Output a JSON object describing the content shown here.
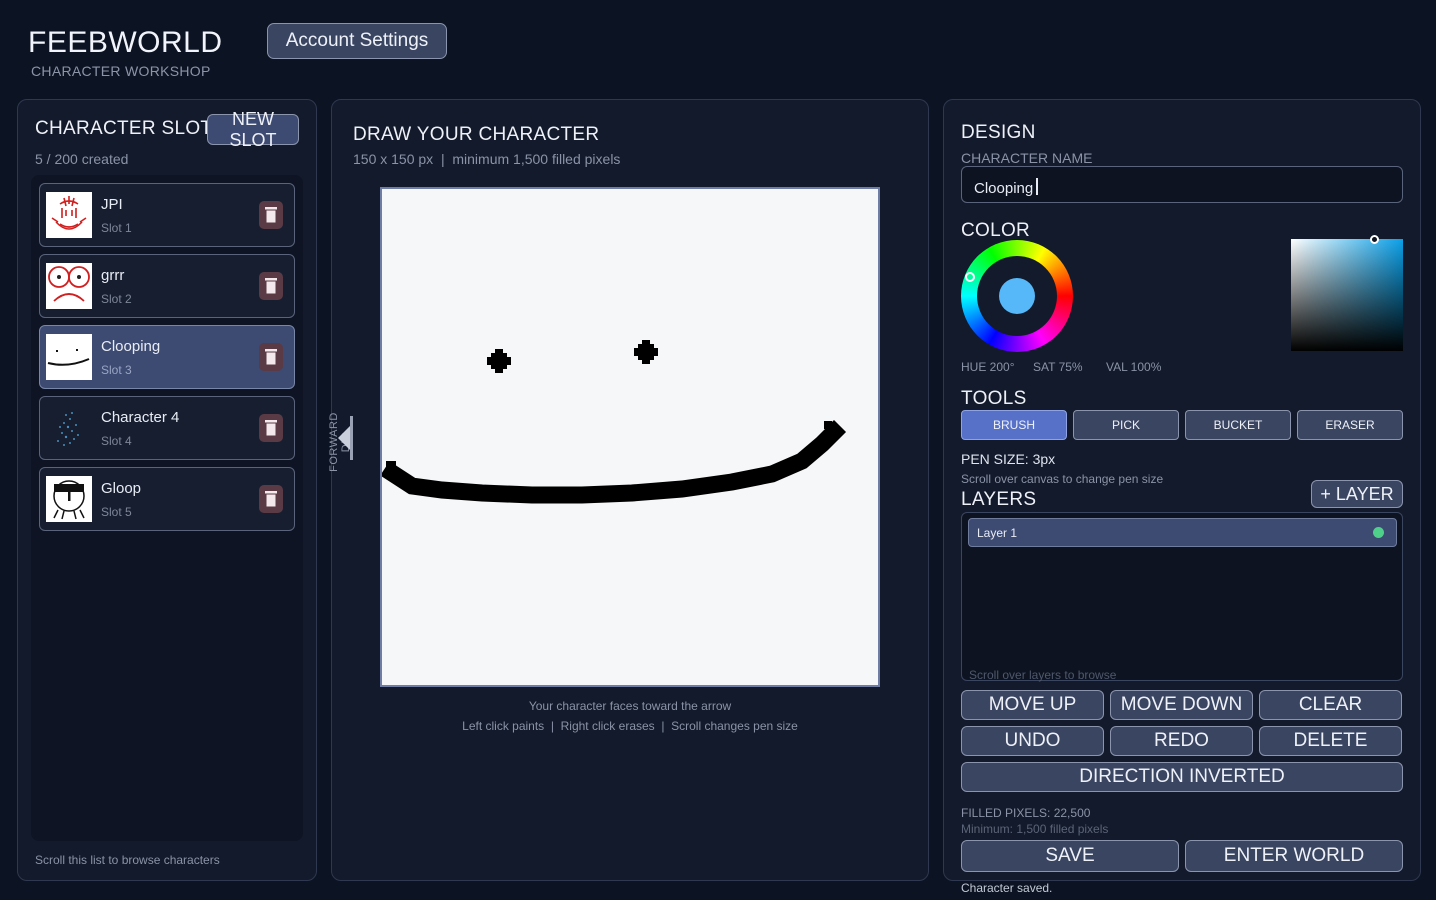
{
  "header": {
    "title": "FEEBWORLD",
    "subtitle": "CHARACTER WORKSHOP",
    "account_button": "Account Settings"
  },
  "slots_panel": {
    "title": "CHARACTER SLOTS",
    "new_slot_button": "NEW SLOT",
    "count_text": "5 / 200 created",
    "footer_hint": "Scroll this list to browse characters",
    "items": [
      {
        "name": "JPI",
        "slot": "Slot 1",
        "active": false
      },
      {
        "name": "grrr",
        "slot": "Slot 2",
        "active": false
      },
      {
        "name": "Clooping",
        "slot": "Slot 3",
        "active": true
      },
      {
        "name": "Character 4",
        "slot": "Slot 4",
        "active": false
      },
      {
        "name": "Gloop",
        "slot": "Slot 5",
        "active": false
      }
    ]
  },
  "draw_panel": {
    "title": "DRAW YOUR CHARACTER",
    "size_info": "150 x 150 px  |  minimum 1,500 filled pixels",
    "forward_label": "FORWARD DIR",
    "hint_1": "Your character faces toward the arrow",
    "hint_2": "Left click paints  |  Right click erases  |  Scroll changes pen size"
  },
  "design_panel": {
    "title": "DESIGN",
    "name_label": "CHARACTER NAME",
    "name_value": "Clooping",
    "color_label": "COLOR",
    "hue_text": "HUE 200°",
    "sat_text": "SAT 75%",
    "val_text": "VAL 100%",
    "current_color": "#56b8f8",
    "tools_label": "TOOLS",
    "tools": [
      "BRUSH",
      "PICK",
      "BUCKET",
      "ERASER"
    ],
    "selected_tool": "BRUSH",
    "pen_size_text": "PEN SIZE: 3px",
    "pen_size_hint": "Scroll over canvas to change pen size",
    "layers_label": "LAYERS",
    "add_layer_button": "+ LAYER",
    "layers": [
      {
        "name": "Layer 1",
        "visible_dot_color": "#4fd08a"
      }
    ],
    "layers_hint": "Scroll over layers to browse",
    "buttons": {
      "move_up": "MOVE UP",
      "move_down": "MOVE DOWN",
      "clear": "CLEAR",
      "undo": "UNDO",
      "redo": "REDO",
      "delete": "DELETE",
      "direction": "DIRECTION INVERTED",
      "save": "SAVE",
      "enter_world": "ENTER WORLD"
    },
    "filled_pixels_text": "FILLED PIXELS: 22,500",
    "minimum_text": "Minimum: 1,500 filled pixels",
    "status_text": "Character saved."
  }
}
